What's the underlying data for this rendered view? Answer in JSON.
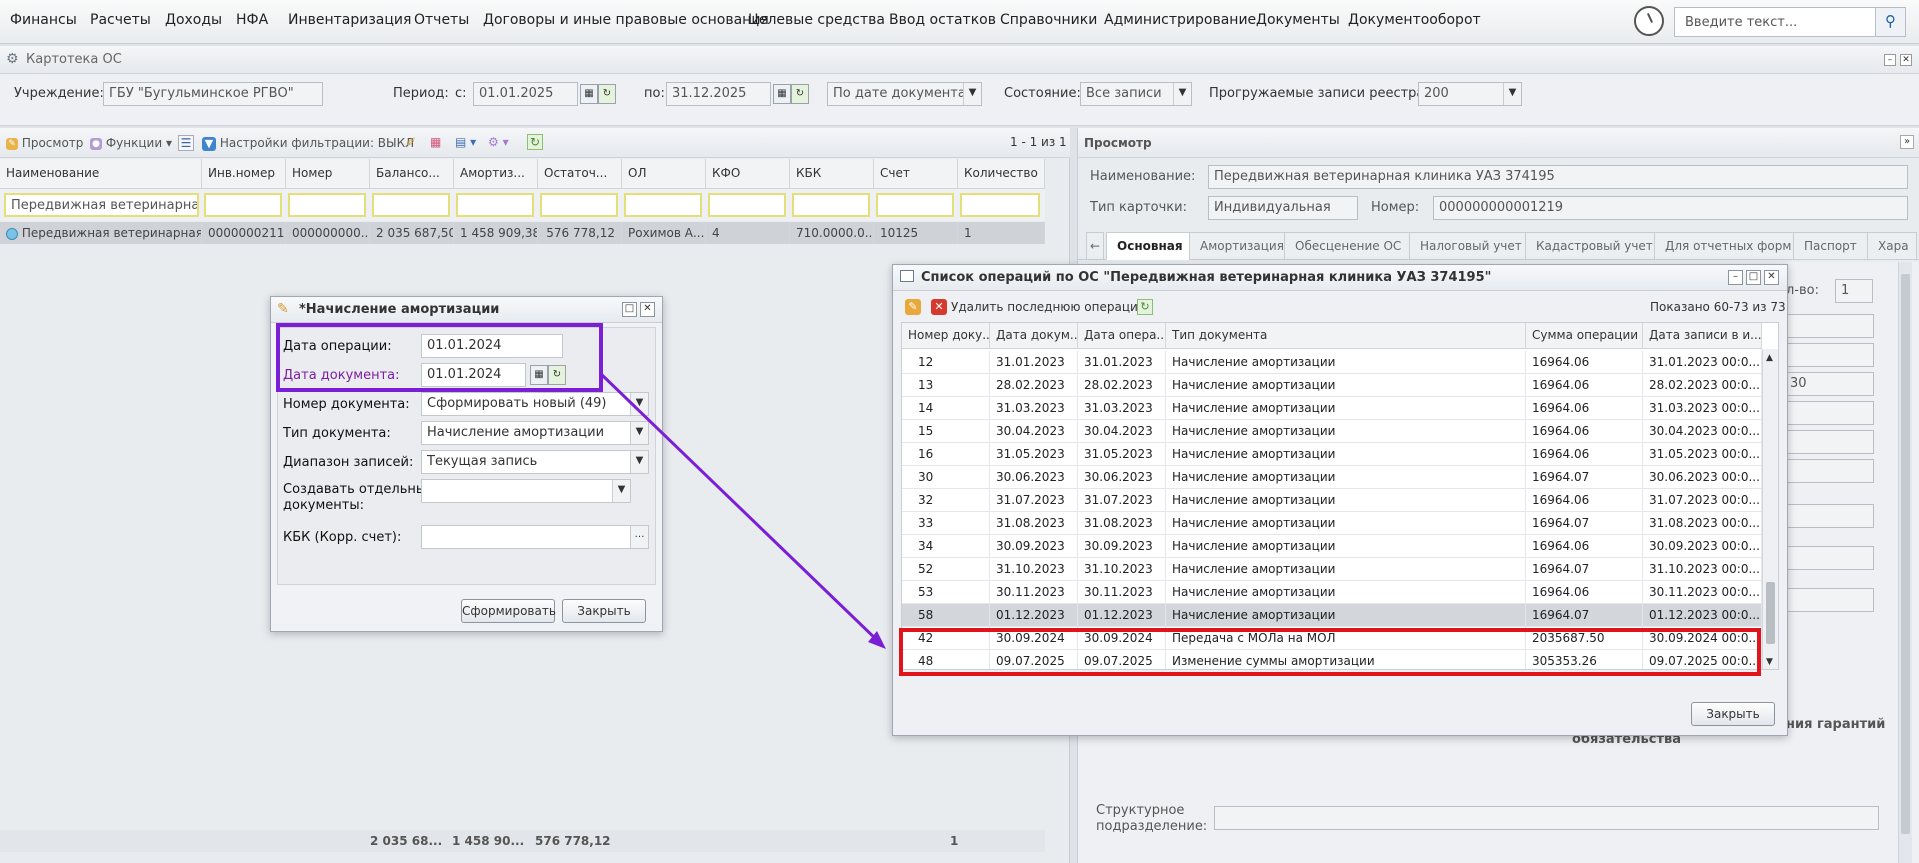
{
  "menu": [
    "Финансы",
    "Расчеты",
    "Доходы",
    "НФА",
    "Инвентаризация",
    "Отчеты",
    "Договоры и иные правовые основания",
    "Целевые средства",
    "Ввод остатков",
    "Справочники",
    "Администрирование",
    "Документы",
    "Документооборот"
  ],
  "search": {
    "placeholder": "Введите текст..."
  },
  "kartoteka": {
    "title": "Картотека ОС",
    "uchrezhdenie_label": "Учреждение:",
    "uchrezhdenie_value": "ГБУ \"Бугульминское РГВО\"",
    "period_label": "Период:",
    "s_label": "с:",
    "s_value": "01.01.2025",
    "po_label": "по:",
    "po_value": "31.12.2025",
    "by_date": "По дате документа",
    "state_label": "Состояние:",
    "state_value": "Все записи",
    "records_label": "Прогружаемые записи реестра:",
    "records_value": "200"
  },
  "toolbar": {
    "view": "Просмотр",
    "functions": "Функции",
    "filter": "Настройки фильтрации: ВЫКЛ",
    "paging": "1 - 1 из 1"
  },
  "grid": {
    "headers": [
      "Наименование",
      "Инв.номер",
      "Номер",
      "Балансо...",
      "Амортиз...",
      "Остаточ...",
      "ОЛ",
      "КФО",
      "КБК",
      "Счет",
      "Количество"
    ],
    "filter_value": "Передвижная ветеринарная к",
    "row": [
      "Передвижная ветеринарная...",
      "0000000211",
      "000000000...",
      "2 035 687,50",
      "1 458 909,38",
      "576 778,12",
      "Рохимов А...",
      "4",
      "710.0000.0...",
      "10125",
      "1"
    ],
    "totals": [
      "2 035 68...",
      "1 458 90...",
      "576 778,12",
      "1"
    ]
  },
  "prosmotr": {
    "title": "Просмотр",
    "name_label": "Наименование:",
    "name_value": "Передвижная ветеринарная клиника УАЗ 374195",
    "type_label": "Тип карточки:",
    "type_value": "Индивидуальная",
    "number_label": "Номер:",
    "number_value": "000000000001219",
    "tabs": [
      "Основная",
      "Амортизация",
      "Обесценение ОС",
      "Налоговый учет",
      "Кадастровый учет",
      "Для отчетных форм",
      "Паспорт",
      "Хара"
    ],
    "kol_vo": "л-во:",
    "kol_vo_value": "1",
    "partial_30": "30",
    "garant_1": "ния гарантий",
    "garant_2": "обязательства",
    "struct_label_1": "Структурное",
    "struct_label_2": "подразделение:"
  },
  "amort_dialog": {
    "title": "*Начисление амортизации",
    "date_op_label": "Дата операции:",
    "date_op_value": "01.01.2024",
    "date_doc_label": "Дата документа:",
    "date_doc_value": "01.01.2024",
    "doc_num_label": "Номер документа:",
    "doc_num_value": "Сформировать новый (49)",
    "doc_type_label": "Тип документа:",
    "doc_type_value": "Начисление амортизации",
    "range_label": "Диапазон записей:",
    "range_value": "Текущая запись",
    "separate_label_1": "Создавать отдельные",
    "separate_label_2": "документы:",
    "kbk_label": "КБК (Корр. счет):",
    "form_button": "Сформировать",
    "close_button": "Закрыть"
  },
  "ops_dialog": {
    "title": "Список операций по ОС \"Передвижная ветеринарная клиника УАЗ 374195\"",
    "delete_last": "Удалить последнюю операцию",
    "shown": "Показано 60-73 из 73",
    "headers": [
      "Номер доку...",
      "Дата докум...",
      "Дата опера...",
      "Тип документа",
      "Сумма операции",
      "Дата записи в и..."
    ],
    "rows": [
      [
        "12",
        "31.01.2023",
        "31.01.2023",
        "Начисление амортизации",
        "16964.06",
        "31.01.2023 00:0..."
      ],
      [
        "13",
        "28.02.2023",
        "28.02.2023",
        "Начисление амортизации",
        "16964.06",
        "28.02.2023 00:0..."
      ],
      [
        "14",
        "31.03.2023",
        "31.03.2023",
        "Начисление амортизации",
        "16964.06",
        "31.03.2023 00:0..."
      ],
      [
        "15",
        "30.04.2023",
        "30.04.2023",
        "Начисление амортизации",
        "16964.06",
        "30.04.2023 00:0..."
      ],
      [
        "16",
        "31.05.2023",
        "31.05.2023",
        "Начисление амортизации",
        "16964.06",
        "31.05.2023 00:0..."
      ],
      [
        "30",
        "30.06.2023",
        "30.06.2023",
        "Начисление амортизации",
        "16964.07",
        "30.06.2023 00:0..."
      ],
      [
        "32",
        "31.07.2023",
        "31.07.2023",
        "Начисление амортизации",
        "16964.06",
        "31.07.2023 00:0..."
      ],
      [
        "33",
        "31.08.2023",
        "31.08.2023",
        "Начисление амортизации",
        "16964.07",
        "31.08.2023 00:0..."
      ],
      [
        "34",
        "30.09.2023",
        "30.09.2023",
        "Начисление амортизации",
        "16964.06",
        "30.09.2023 00:0..."
      ],
      [
        "52",
        "31.10.2023",
        "31.10.2023",
        "Начисление амортизации",
        "16964.07",
        "31.10.2023 00:0..."
      ],
      [
        "53",
        "30.11.2023",
        "30.11.2023",
        "Начисление амортизации",
        "16964.06",
        "30.11.2023 00:0..."
      ],
      [
        "58",
        "01.12.2023",
        "01.12.2023",
        "Начисление амортизации",
        "16964.07",
        "01.12.2023 00:0..."
      ],
      [
        "42",
        "30.09.2024",
        "30.09.2024",
        "Передача с МОЛа на МОЛ",
        "2035687.50",
        "30.09.2024 00:0..."
      ],
      [
        "48",
        "09.07.2025",
        "09.07.2025",
        "Изменение суммы амортизации",
        "305353.26",
        "09.07.2025 00:0..."
      ]
    ],
    "close_button": "Закрыть"
  },
  "colors": {
    "purple": "#7a1fd6",
    "red": "#e0141b",
    "accent": "#1f5ea8"
  }
}
